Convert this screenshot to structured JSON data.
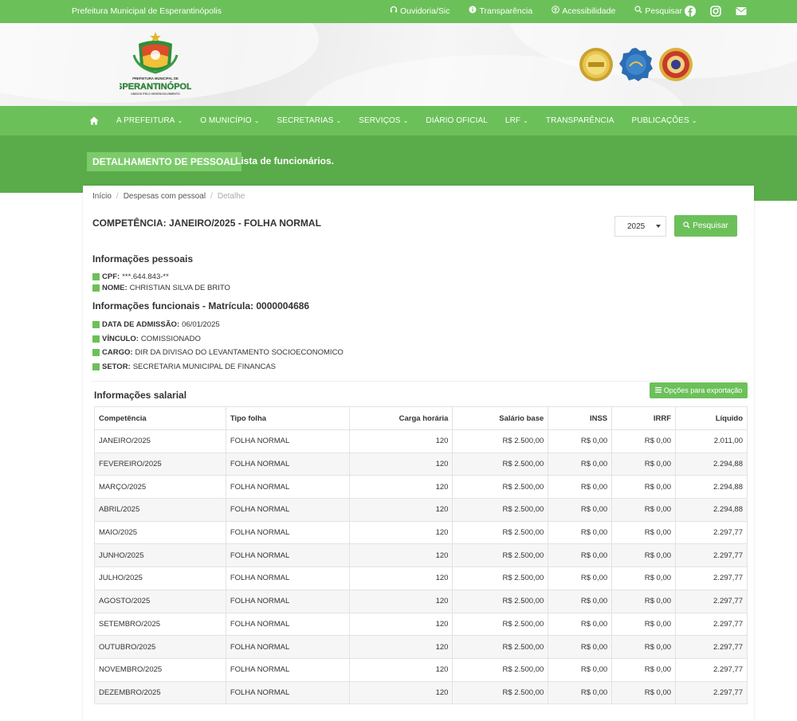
{
  "topbar": {
    "site_name": "Prefeitura Municipal de Esperantinópolis",
    "links": [
      {
        "label": "Ouvidoria/Sic",
        "icon": "headset-icon"
      },
      {
        "label": "Transparência",
        "icon": "info-icon"
      },
      {
        "label": "Acessibilidade",
        "icon": "accessibility-icon"
      },
      {
        "label": "Pesquisar",
        "icon": "search-icon"
      }
    ],
    "social": [
      "facebook-icon",
      "instagram-icon",
      "email-icon"
    ]
  },
  "header": {
    "logo_text": [
      "PREFEITURA MUNICIPAL DE",
      "ESPERANTINÓPOLIS",
      "UNIDOS PELO DESENVOLVIMENTO"
    ]
  },
  "nav": {
    "items": [
      {
        "label": "A PREFEITURA",
        "dropdown": true
      },
      {
        "label": "O MUNICÍPIO",
        "dropdown": true
      },
      {
        "label": "SECRETARIAS",
        "dropdown": true
      },
      {
        "label": "SERVIÇOS",
        "dropdown": true
      },
      {
        "label": "DIÁRIO OFICIAL",
        "dropdown": false
      },
      {
        "label": "LRF",
        "dropdown": true
      },
      {
        "label": "TRANSPARÊNCIA",
        "dropdown": false
      },
      {
        "label": "PUBLICAÇÕES",
        "dropdown": true
      }
    ]
  },
  "hero": {
    "title": "DETALHAMENTO DE PESSOAL",
    "subtitle": "Lista de funcionários."
  },
  "breadcrumb": {
    "items": [
      "Início",
      "Despesas com pessoal",
      "Detalhe"
    ]
  },
  "page": {
    "competencia": "COMPETÊNCIA: JANEIRO/2025 - FOLHA NORMAL",
    "year_selected": "2025",
    "search_label": "Pesquisar"
  },
  "personal": {
    "title": "Informações pessoais",
    "fields": [
      {
        "label": "CPF:",
        "value": "***.644.843-**"
      },
      {
        "label": "NOME:",
        "value": "CHRISTIAN SILVA DE BRITO"
      }
    ]
  },
  "functional": {
    "title": "Informações funcionais - Matrícula: 0000004686",
    "fields": [
      {
        "label": "DATA DE ADMISSÃO:",
        "value": "06/01/2025"
      },
      {
        "label": "VÍNCULO:",
        "value": "COMISSIONADO"
      },
      {
        "label": "CARGO:",
        "value": "DIR DA DIVISAO DO LEVANTAMENTO SOCIOECONOMICO"
      },
      {
        "label": "SETOR:",
        "value": "SECRETARIA MUNICIPAL DE FINANCAS"
      }
    ]
  },
  "salary": {
    "title": "Informações salarial",
    "export_label": "Opções para exportação",
    "columns": [
      "Competência",
      "Tipo folha",
      "Carga horária",
      "Salário base",
      "INSS",
      "IRRF",
      "Líquido"
    ],
    "rows": [
      [
        "JANEIRO/2025",
        "FOLHA NORMAL",
        "120",
        "R$ 2.500,00",
        "R$ 0,00",
        "R$ 0,00",
        "2.011,00"
      ],
      [
        "FEVEREIRO/2025",
        "FOLHA NORMAL",
        "120",
        "R$ 2.500,00",
        "R$ 0,00",
        "R$ 0,00",
        "2.294,88"
      ],
      [
        "MARÇO/2025",
        "FOLHA NORMAL",
        "120",
        "R$ 2.500,00",
        "R$ 0,00",
        "R$ 0,00",
        "2.294,88"
      ],
      [
        "ABRIL/2025",
        "FOLHA NORMAL",
        "120",
        "R$ 2.500,00",
        "R$ 0,00",
        "R$ 0,00",
        "2.294,88"
      ],
      [
        "MAIO/2025",
        "FOLHA NORMAL",
        "120",
        "R$ 2.500,00",
        "R$ 0,00",
        "R$ 0,00",
        "2.297,77"
      ],
      [
        "JUNHO/2025",
        "FOLHA NORMAL",
        "120",
        "R$ 2.500,00",
        "R$ 0,00",
        "R$ 0,00",
        "2.297,77"
      ],
      [
        "JULHO/2025",
        "FOLHA NORMAL",
        "120",
        "R$ 2.500,00",
        "R$ 0,00",
        "R$ 0,00",
        "2.297,77"
      ],
      [
        "AGOSTO/2025",
        "FOLHA NORMAL",
        "120",
        "R$ 2.500,00",
        "R$ 0,00",
        "R$ 0,00",
        "2.297,77"
      ],
      [
        "SETEMBRO/2025",
        "FOLHA NORMAL",
        "120",
        "R$ 2.500,00",
        "R$ 0,00",
        "R$ 0,00",
        "2.297,77"
      ],
      [
        "OUTUBRO/2025",
        "FOLHA NORMAL",
        "120",
        "R$ 2.500,00",
        "R$ 0,00",
        "R$ 0,00",
        "2.297,77"
      ],
      [
        "NOVEMBRO/2025",
        "FOLHA NORMAL",
        "120",
        "R$ 2.500,00",
        "R$ 0,00",
        "R$ 0,00",
        "2.297,77"
      ],
      [
        "DEZEMBRO/2025",
        "FOLHA NORMAL",
        "120",
        "R$ 2.500,00",
        "R$ 0,00",
        "R$ 0,00",
        "2.297,77"
      ]
    ]
  },
  "colors": {
    "brand_green": "#6cc05a",
    "hero_green": "#5aac4a",
    "title_box_green": "#7ccb6b"
  }
}
